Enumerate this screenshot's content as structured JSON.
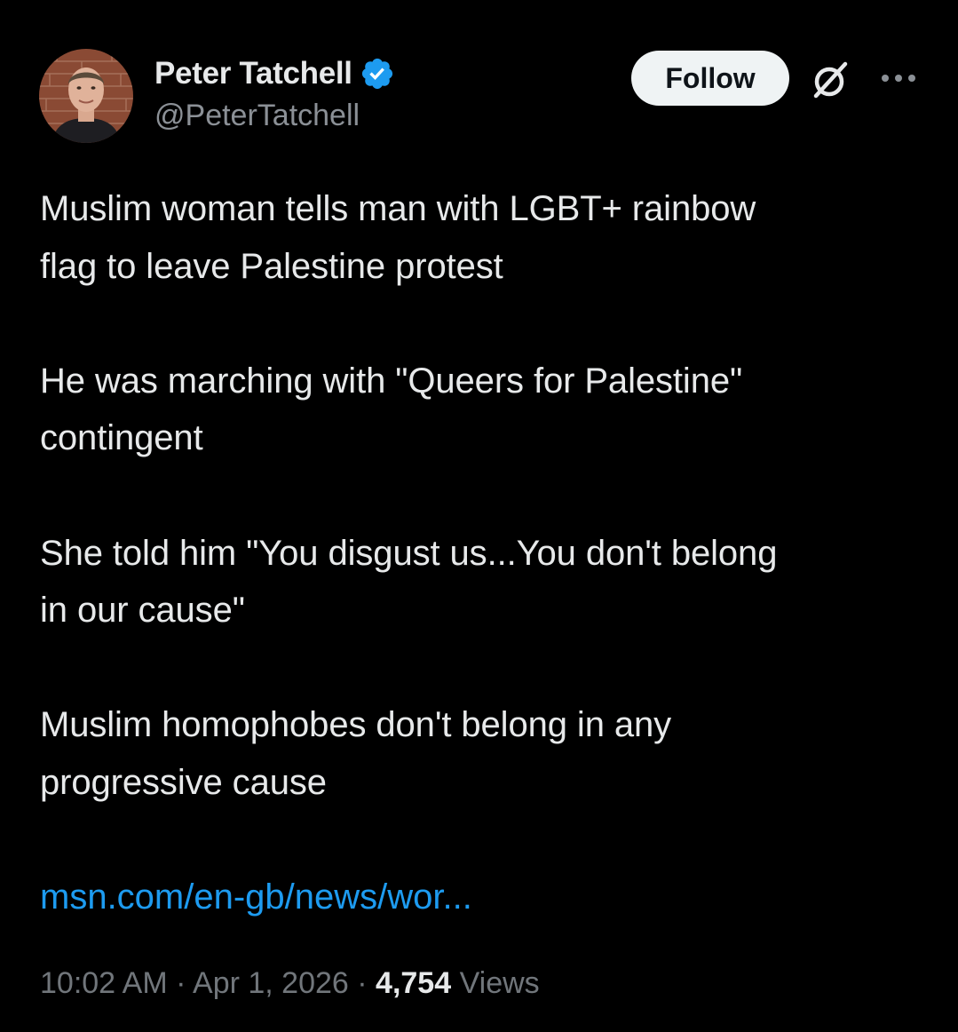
{
  "author": {
    "display_name": "Peter Tatchell",
    "handle": "@PeterTatchell",
    "verified": true,
    "verified_color": "#1d9bf0"
  },
  "actions": {
    "follow_label": "Follow",
    "grok_icon": "grok-icon",
    "more_icon": "more-icon"
  },
  "tweet": {
    "text": "Muslim woman tells man with LGBT+ rainbow\nflag to leave Palestine protest\n\nHe was marching with \"Queers for Palestine\"\ncontingent\n\nShe told him \"You disgust us...You don't belong\nin our cause\"\n\nMuslim homophobes don't belong in any\nprogressive cause",
    "link": "msn.com/en-gb/news/wor...",
    "time": "10:02 AM",
    "date": "Apr 1, 2026",
    "separator": "·",
    "views_count": "4,754",
    "views_label": "Views"
  },
  "colors": {
    "background": "#000000",
    "text": "#e7e9ea",
    "secondary": "#71767b",
    "link": "#1d9bf0",
    "button_bg": "#eff3f4"
  }
}
